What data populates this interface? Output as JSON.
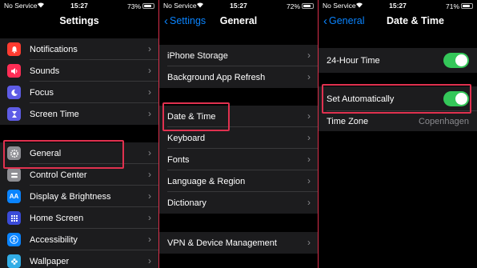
{
  "status": [
    {
      "carrier": "No Service",
      "time": "15:27",
      "battery": "73%",
      "battery_level": 0.73
    },
    {
      "carrier": "No Service",
      "time": "15:27",
      "battery": "72%",
      "battery_level": 0.72
    },
    {
      "carrier": "No Service",
      "time": "15:27",
      "battery": "71%",
      "battery_level": 0.71
    }
  ],
  "settings": {
    "title": "Settings",
    "items": [
      {
        "label": "Notifications",
        "icon": "bell-icon"
      },
      {
        "label": "Sounds",
        "icon": "speaker-icon"
      },
      {
        "label": "Focus",
        "icon": "moon-icon"
      },
      {
        "label": "Screen Time",
        "icon": "hourglass-icon"
      },
      {
        "label": "General",
        "icon": "gear-icon"
      },
      {
        "label": "Control Center",
        "icon": "toggles-icon"
      },
      {
        "label": "Display & Brightness",
        "icon": "text-size-icon"
      },
      {
        "label": "Home Screen",
        "icon": "grid-icon"
      },
      {
        "label": "Accessibility",
        "icon": "accessibility-icon"
      },
      {
        "label": "Wallpaper",
        "icon": "flower-icon"
      }
    ]
  },
  "general": {
    "back": "Settings",
    "title": "General",
    "items": [
      {
        "label": "iPhone Storage"
      },
      {
        "label": "Background App Refresh"
      },
      {
        "label": "Date & Time"
      },
      {
        "label": "Keyboard"
      },
      {
        "label": "Fonts"
      },
      {
        "label": "Language & Region"
      },
      {
        "label": "Dictionary"
      },
      {
        "label": "VPN & Device Management"
      }
    ]
  },
  "datetime": {
    "back": "General",
    "title": "Date & Time",
    "hour24": {
      "label": "24-Hour Time",
      "on": true
    },
    "auto": {
      "label": "Set Automatically",
      "on": true
    },
    "timezone": {
      "label": "Time Zone",
      "value": "Copenhagen"
    }
  },
  "colors": {
    "toggle_on": "#34c759",
    "highlight": "#e0314f",
    "link": "#0a84ff"
  }
}
